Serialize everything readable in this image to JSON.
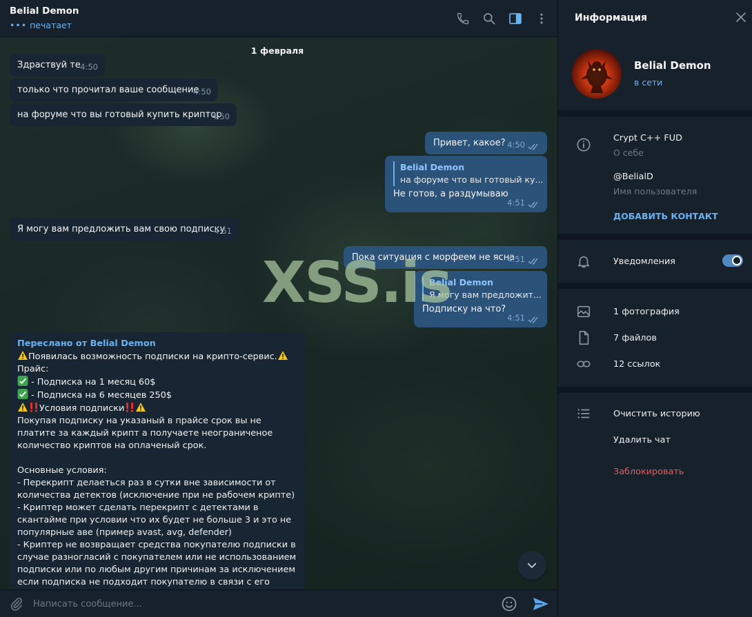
{
  "header": {
    "name": "Belial Demon",
    "status_dots": "•••",
    "status": "печатает"
  },
  "date_divider": "1 февраля",
  "messages_in": [
    {
      "text": "Здраствуй те",
      "time": "4:50"
    },
    {
      "text": "только что прочитал ваше сообщение",
      "time": "4:50"
    },
    {
      "text": "на форуме что вы готовый купить криптор",
      "time": "4:50"
    },
    {
      "text": "Я могу вам предложить вам свою подписку",
      "time": "4:51"
    }
  ],
  "messages_out": [
    {
      "text": "Привет, какое?",
      "time": "4:50"
    },
    {
      "reply_name": "Belial Demon",
      "reply_text": "на форуме что вы готовый ку...",
      "text": "Не готов, а раздумываю",
      "time": "4:51"
    },
    {
      "text": "Пока ситуация с морфеем не ясна",
      "time": "4:51"
    },
    {
      "reply_name": "Belial Demon",
      "reply_text": "Я могу вам предложит...",
      "text": "Подписку на что?",
      "time": "4:51"
    }
  ],
  "forwarded": {
    "from": "Переслано от Belial Demon",
    "line1": "Появилась возможность подписки на крипто-сервис.",
    "line2": "Прайс:",
    "line3": " - Подписка на 1 месяц 60$",
    "line4": " - Подписка на 6 месяцев 250$",
    "line5": "Условия подписки",
    "body": "Покупая подписку на указаный в прайсе срок вы не платите за каждый крипт а получаете неограниченое количество криптов на оплаченый срок.\n\nОсновные условия:\n- Перекрипт делаеться раз в сутки вне зависимости от количества детектов (исключение при не рабочем крипте)\n- Криптер может сделать перекрипт с детектами в скантайме при условии что их будет не больше 3 и это не популярные аве (пример avast, avg, defender)\n- Криптер не возвращает средства покупателю подписки в случае разногласий с покупателем или не использованием подписки или по любым другим причинам за исключением если подписка не подходит покупателю в связи с его файлами"
  },
  "watermark": "XSS.is",
  "composer": {
    "placeholder": "Написать сообщение..."
  },
  "info": {
    "title": "Информация",
    "name": "Belial Demon",
    "status": "в сети",
    "bio": "Crypt C++ FUD",
    "bio_label": "О себе",
    "username": "@BelialD",
    "username_label": "Имя пользователя",
    "add_contact": "ДОБАВИТЬ КОНТАКТ",
    "notifications": "Уведомления",
    "notifications_on": true,
    "photos": "1 фотография",
    "files": "7 файлов",
    "links": "12 ссылок",
    "clear_history": "Очистить историю",
    "delete_chat": "Удалить чат",
    "block": "Заблокировать"
  },
  "colors": {
    "accent": "#6ab3f3",
    "outgoing_bubble": "#2b5278",
    "incoming_bubble": "#182533",
    "danger": "#e05c5c"
  }
}
